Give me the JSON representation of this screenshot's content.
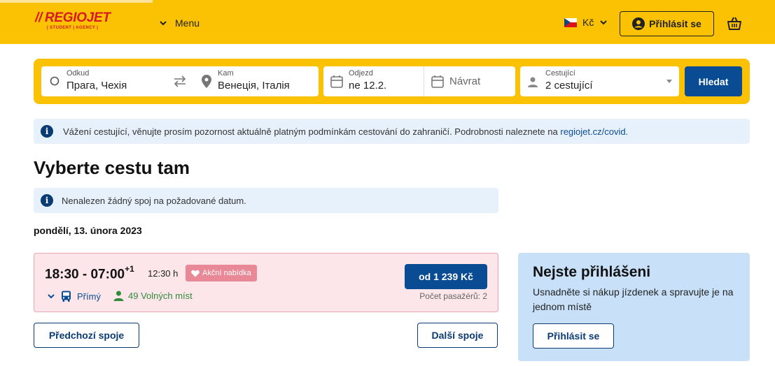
{
  "header": {
    "logo_text": "REGIOJET",
    "logo_slashes": "//",
    "logo_sub": "| STUDENT | AGENCY |",
    "menu_label": "Menu",
    "currency": "Kč",
    "login_label": "Přihlásit se"
  },
  "search": {
    "from_label": "Odkud",
    "from_value": "Прага, Чехія",
    "to_label": "Kam",
    "to_value": "Венеція, Італія",
    "departure_label": "Odjezd",
    "departure_value": "ne 12.2.",
    "return_placeholder": "Návrat",
    "passengers_label": "Cestující",
    "passengers_value": "2 cestující",
    "button_label": "Hledat"
  },
  "notice_covid": {
    "text": "Vážení cestující, věnujte prosím pozornost aktuálně platným podmínkám cestování do zahraničí. Podrobnosti naleznete na",
    "link": "regiojet.cz/covid."
  },
  "page_title": "Vyberte cestu tam",
  "notice_nodate": {
    "text": "Nenalezen žádný spoj na požadované datum."
  },
  "date_heading": "pondělí, 13. února 2023",
  "trip": {
    "time": "18:30 - 07:00",
    "time_sup": "+1",
    "duration": "12:30 h",
    "badge": "Akční nabídka",
    "type": "Přímý",
    "seats": "49 Volných míst",
    "price": "od 1 239 Kč",
    "passengers": "Počet pasažérů: 2"
  },
  "nav": {
    "prev_label": "Předchozí spoje",
    "next_label": "Další spoje"
  },
  "login_panel": {
    "title": "Nejste přihlášeni",
    "description": "Usnadněte si nákup jízdenek a spravujte je na jednom místě",
    "button_label": "Přihlásit se"
  },
  "colors": {
    "brand_yellow": "#fbc103",
    "brand_blue": "#0a4c94",
    "logo_red": "#d71921",
    "promo_pink": "#fce6e9",
    "info_blue": "#e7f1fb"
  }
}
